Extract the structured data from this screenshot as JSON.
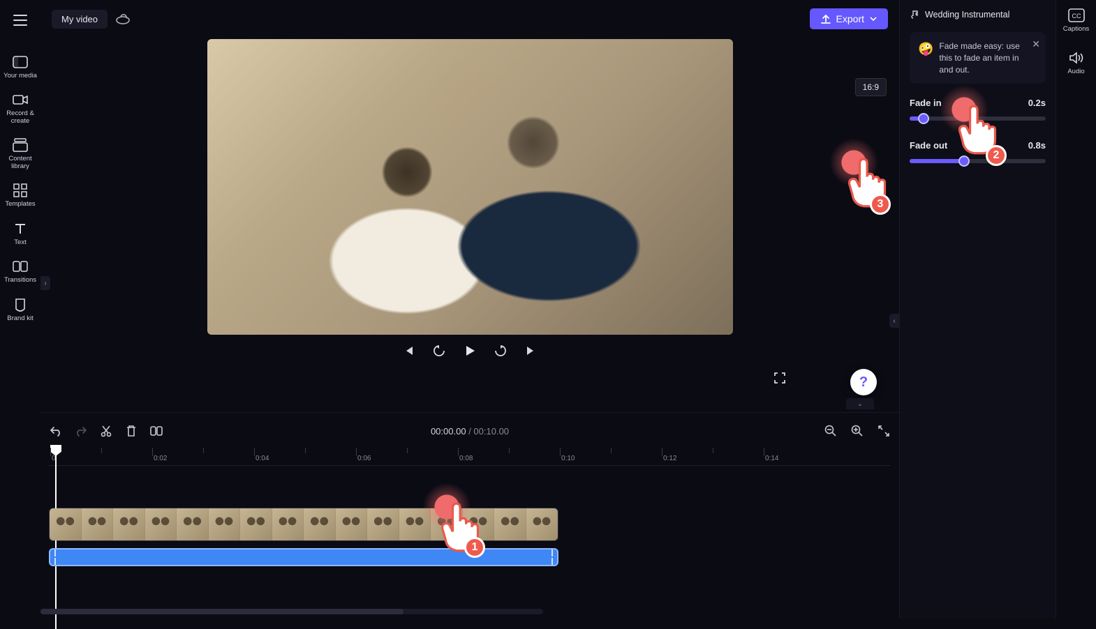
{
  "project": {
    "title": "My video"
  },
  "header": {
    "export_label": "Export",
    "aspect_ratio": "16:9"
  },
  "sidebar": {
    "items": [
      {
        "label": "Your media",
        "icon": "media-icon"
      },
      {
        "label": "Record & create",
        "icon": "record-icon"
      },
      {
        "label": "Content library",
        "icon": "library-icon"
      },
      {
        "label": "Templates",
        "icon": "templates-icon"
      },
      {
        "label": "Text",
        "icon": "text-icon"
      },
      {
        "label": "Transitions",
        "icon": "transitions-icon"
      },
      {
        "label": "Brand kit",
        "icon": "brandkit-icon"
      }
    ]
  },
  "right_sidebar": {
    "items": [
      {
        "label": "Captions",
        "icon": "cc-icon"
      },
      {
        "label": "Audio",
        "icon": "speaker-icon"
      }
    ]
  },
  "selected_audio": {
    "name": "Wedding Instrumental"
  },
  "tip": {
    "emoji": "🤪",
    "text": "Fade made easy: use this to fade an item in and out."
  },
  "fade": {
    "in_label": "Fade in",
    "in_value": "0.2s",
    "in_percent": 10,
    "out_label": "Fade out",
    "out_value": "0.8s",
    "out_percent": 40
  },
  "timeline": {
    "current": "00:00.00",
    "total": "00:10.00",
    "ticks": [
      "0",
      "0:02",
      "0:04",
      "0:06",
      "0:08",
      "0:10",
      "0:12",
      "0:14"
    ]
  },
  "annotations": {
    "p1": "1",
    "p2": "2",
    "p3": "3"
  }
}
